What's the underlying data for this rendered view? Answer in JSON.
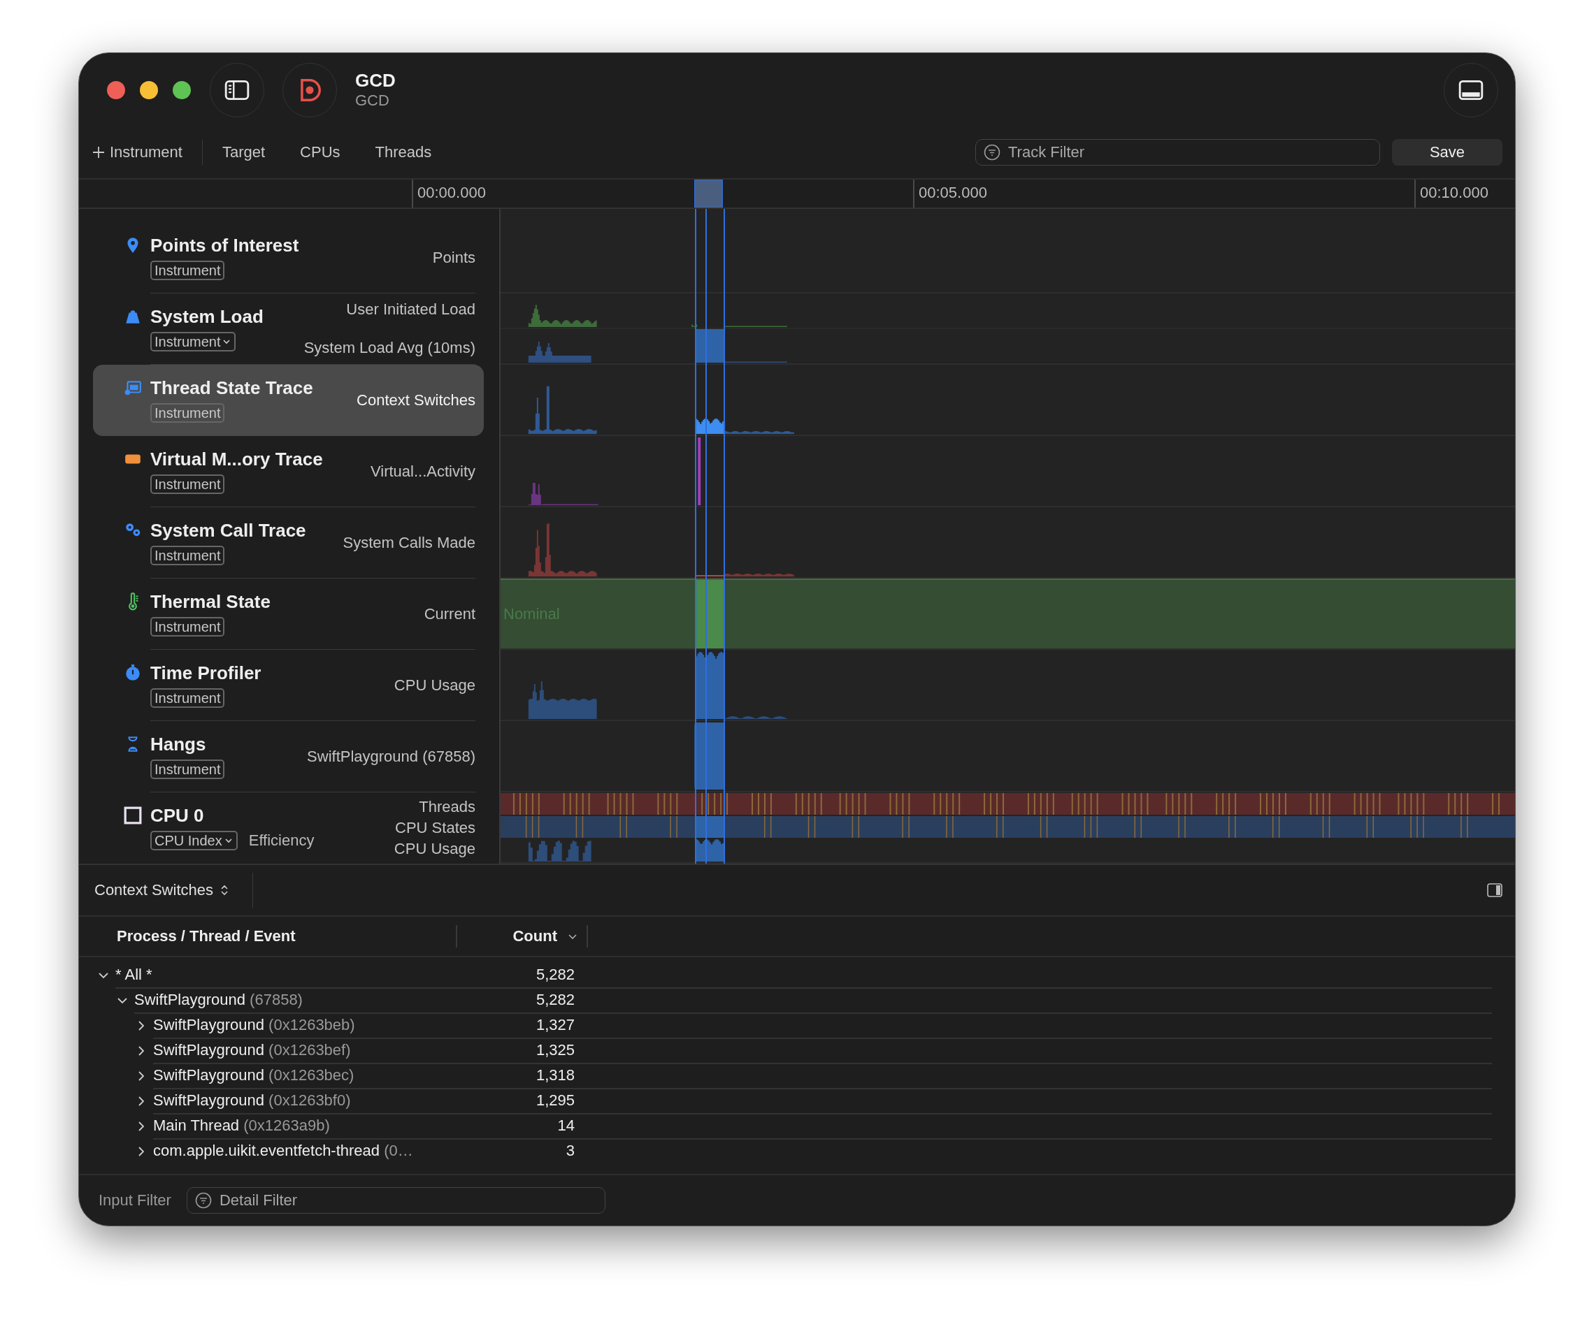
{
  "window": {
    "title": "GCD",
    "subtitle": "GCD"
  },
  "toolbar": {
    "add_label": "Instrument",
    "tabs": [
      {
        "label": "Target"
      },
      {
        "label": "CPUs"
      },
      {
        "label": "Threads"
      }
    ],
    "filter": {
      "placeholder": "Track Filter"
    },
    "save": "Save"
  },
  "ruler": {
    "labels": [
      "00:00.000",
      "00:05.000",
      "00:10.000"
    ]
  },
  "tracks": [
    {
      "kind": "points",
      "title": "Points of Interest",
      "badge": "Instrument",
      "badge_menu": false,
      "labels": [
        "Points"
      ],
      "selected": false
    },
    {
      "kind": "load",
      "title": "System Load",
      "badge": "Instrument",
      "badge_menu": true,
      "labels": [
        "User Initiated Load",
        "System Load Avg (10ms)"
      ],
      "selected": false
    },
    {
      "kind": "threads",
      "title": "Thread State Trace",
      "badge": "Instrument",
      "badge_menu": false,
      "labels": [
        "Context Switches"
      ],
      "selected": true
    },
    {
      "kind": "memory",
      "title": "Virtual M...ory Trace",
      "badge": "Instrument",
      "badge_menu": false,
      "labels": [
        "Virtual...Activity"
      ],
      "selected": false
    },
    {
      "kind": "syscalls",
      "title": "System Call Trace",
      "badge": "Instrument",
      "badge_menu": false,
      "labels": [
        "System Calls Made"
      ],
      "selected": false
    },
    {
      "kind": "thermal",
      "title": "Thermal State",
      "badge": "Instrument",
      "badge_menu": false,
      "labels": [
        "Current"
      ],
      "lane_text": "Nominal",
      "selected": false
    },
    {
      "kind": "profiler",
      "title": "Time Profiler",
      "badge": "Instrument",
      "badge_menu": false,
      "labels": [
        "CPU Usage"
      ],
      "selected": false
    },
    {
      "kind": "hangs",
      "title": "Hangs",
      "badge": "Instrument",
      "badge_menu": false,
      "labels": [
        "SwiftPlayground (67858)"
      ],
      "selected": false
    },
    {
      "kind": "cpu",
      "title": "CPU 0",
      "badge": "CPU Index",
      "badge_menu": true,
      "extra": "Efficiency",
      "labels": [
        "Threads",
        "CPU States",
        "CPU Usage"
      ],
      "selected": false
    }
  ],
  "detail": {
    "view_selector": "Context Switches",
    "columns": [
      {
        "label": "Process / Thread / Event",
        "sorted": false
      },
      {
        "label": "Count",
        "sorted": true
      }
    ],
    "rows": [
      {
        "name": "* All *",
        "count": "5,282",
        "expanded": true,
        "children": [
          {
            "name": "SwiftPlayground",
            "detail": "(67858)",
            "count": "5,282",
            "expanded": true,
            "children": [
              {
                "name": "SwiftPlayground",
                "detail": "(0x1263beb)",
                "count": "1,327",
                "expanded": false
              },
              {
                "name": "SwiftPlayground",
                "detail": "(0x1263bef)",
                "count": "1,325",
                "expanded": false
              },
              {
                "name": "SwiftPlayground",
                "detail": "(0x1263bec)",
                "count": "1,318",
                "expanded": false
              },
              {
                "name": "SwiftPlayground",
                "detail": "(0x1263bf0)",
                "count": "1,295",
                "expanded": false
              },
              {
                "name": "Main Thread",
                "detail": "(0x1263a9b)",
                "count": "14",
                "expanded": false
              },
              {
                "name": "com.apple.uikit.eventfetch-thread",
                "detail": "(0…",
                "count": "3",
                "expanded": false
              }
            ]
          }
        ]
      }
    ]
  },
  "filter_bar": {
    "label": "Input Filter",
    "placeholder": "Detail Filter"
  }
}
